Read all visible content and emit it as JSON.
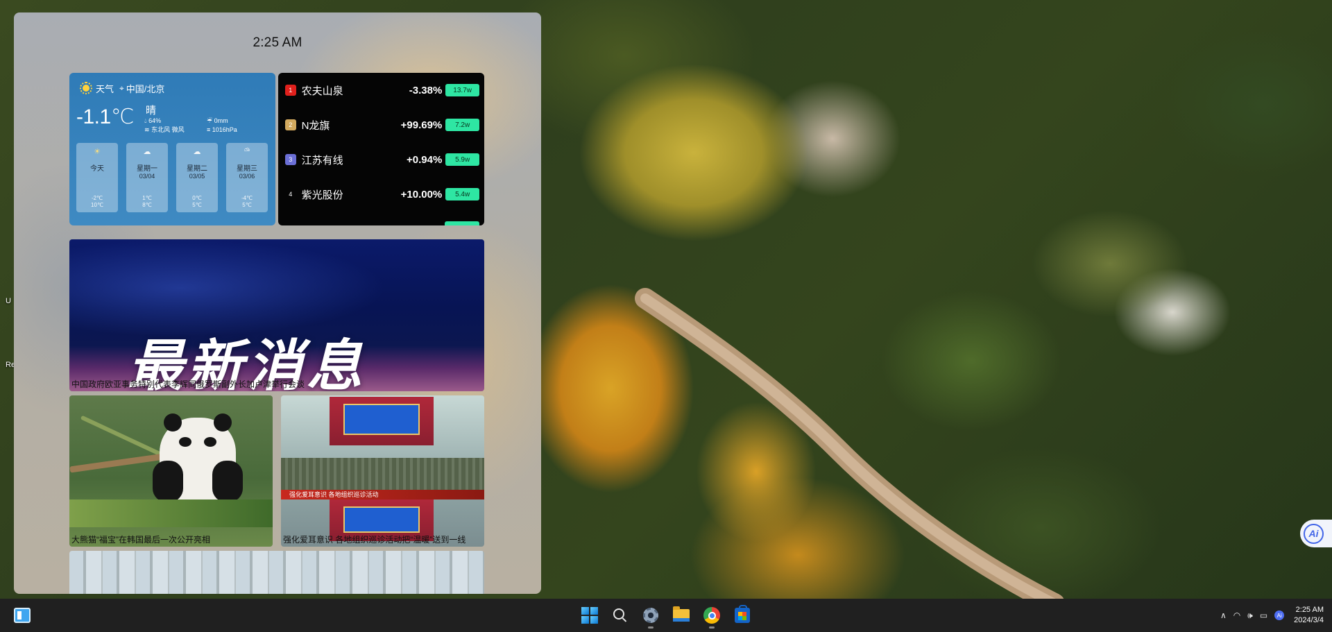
{
  "board": {
    "time": "2:25 AM"
  },
  "weather": {
    "title": "天气",
    "location": "中国/北京",
    "temperature": "-1.1℃",
    "condition": "晴",
    "humidity": "64%",
    "wind": "东北风 微风",
    "rain": "0mm",
    "pressure": "1016hPa",
    "forecast": [
      {
        "name": "今天",
        "date": "",
        "low": "-2℃",
        "high": "10℃",
        "icon": "sun-icon"
      },
      {
        "name": "星期一",
        "date": "03/04",
        "low": "1℃",
        "high": "8℃",
        "icon": "cloud-icon"
      },
      {
        "name": "星期二",
        "date": "03/05",
        "low": "0℃",
        "high": "5℃",
        "icon": "rain-cloud-icon"
      },
      {
        "name": "星期三",
        "date": "03/06",
        "low": "-4℃",
        "high": "5℃",
        "icon": "cloud-sun-icon"
      }
    ]
  },
  "stocks": [
    {
      "rank": "1",
      "name": "农夫山泉",
      "change": "-3.38%",
      "volume": "13.7w",
      "rank_color": "#e0201c"
    },
    {
      "rank": "2",
      "name": "N龙旗",
      "change": "+99.69%",
      "volume": "7.2w",
      "rank_color": "#d2a95e"
    },
    {
      "rank": "3",
      "name": "江苏有线",
      "change": "+0.94%",
      "volume": "5.9w",
      "rank_color": "#6b6fd6"
    },
    {
      "rank": "4",
      "name": "紫光股份",
      "change": "+10.00%",
      "volume": "5.4w",
      "rank_color": "transparent"
    }
  ],
  "news": {
    "hero_text": "最新消息",
    "hero_caption": "中国政府欧亚事务特别代表李辉同俄罗斯副外长加卢津举行会谈",
    "panda_caption": "大熊猫“福宝”在韩国最后一次公开亮相",
    "army_caption": "强化爱耳意识 各地组织巡诊活动把“温暖”送到一线",
    "army_banner": "强化爱耳意识 各地组织巡诊活动"
  },
  "desktop_edge": {
    "label_u": "U",
    "label_re": "Re"
  },
  "taskbar": {
    "clock_time": "2:25 AM",
    "clock_date": "2024/3/4",
    "ai_badge": "Ai",
    "float_ai": "Ai"
  }
}
